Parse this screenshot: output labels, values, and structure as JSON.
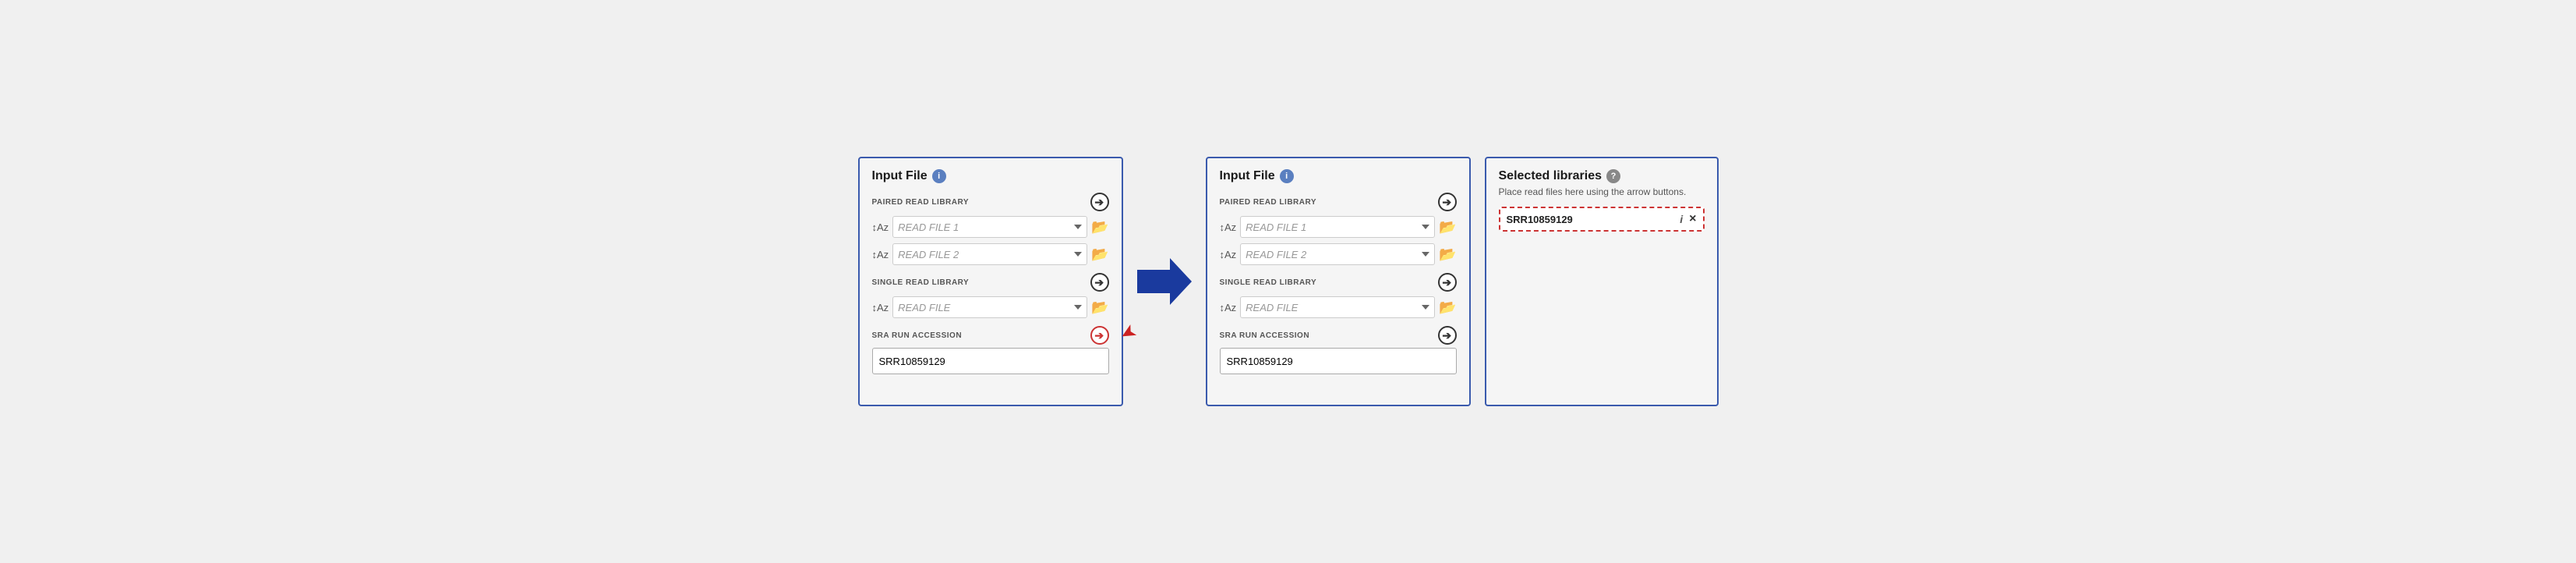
{
  "panel1": {
    "title": "Input File",
    "paired_read_library_label": "PAIRED READ LIBRARY",
    "read_file_1_placeholder": "READ FILE 1",
    "read_file_2_placeholder": "READ FILE 2",
    "single_read_library_label": "SINGLE READ LIBRARY",
    "read_file_placeholder": "READ FILE",
    "sra_run_accession_label": "SRA RUN ACCESSION",
    "sra_value": "SRR10859129"
  },
  "panel2": {
    "title": "Input File",
    "paired_read_library_label": "PAIRED READ LIBRARY",
    "read_file_1_placeholder": "READ FILE 1",
    "read_file_2_placeholder": "READ FILE 2",
    "single_read_library_label": "SINGLE READ LIBRARY",
    "read_file_placeholder": "READ FILE",
    "sra_run_accession_label": "SRA RUN ACCESSION",
    "sra_value": "SRR10859129"
  },
  "libraries_panel": {
    "title": "Selected libraries",
    "subtitle": "Place read files here using the arrow buttons.",
    "items": [
      {
        "name": "SRR10859129"
      }
    ]
  },
  "icons": {
    "info": "i",
    "help": "?",
    "arrow_right_circle": "➔",
    "folder": "📁",
    "sort": "↓A↑Z",
    "sort_display": "↕",
    "chevron_down": "▾",
    "big_arrow": "➤",
    "red_arrow": "➤",
    "close": "×",
    "item_info": "i"
  }
}
